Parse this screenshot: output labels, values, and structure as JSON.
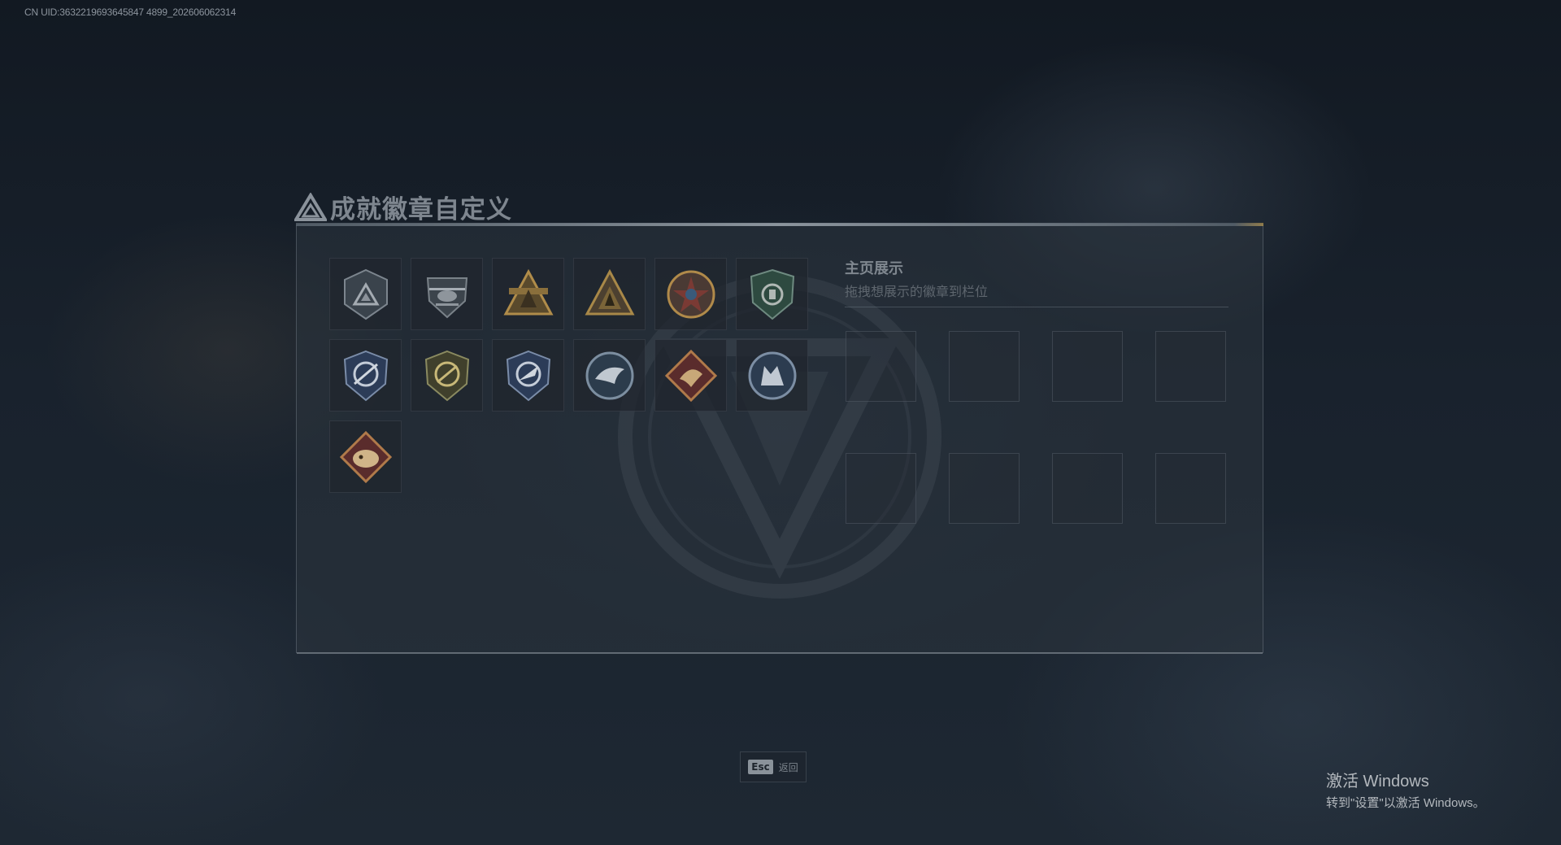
{
  "uid": "CN UID:3632219693645847 4899_202606062314",
  "title": "成就徽章自定义",
  "badges": [
    {
      "name": "triangle-shield-badge"
    },
    {
      "name": "helicopter-badge"
    },
    {
      "name": "gold-triangle-badge"
    },
    {
      "name": "gold-mountain-triangle-badge"
    },
    {
      "name": "star-compass-badge"
    },
    {
      "name": "green-shield-badge"
    },
    {
      "name": "blue-wing-shield-badge"
    },
    {
      "name": "no-jet-shield-badge"
    },
    {
      "name": "blue-jet-shield-badge"
    },
    {
      "name": "eagle-circle-badge"
    },
    {
      "name": "dragon-diamond-badge"
    },
    {
      "name": "wolf-circle-badge"
    },
    {
      "name": "tiger-diamond-badge"
    }
  ],
  "showcase": {
    "title": "主页展示",
    "subtitle": "拖拽想展示的徽章到栏位"
  },
  "esc": {
    "key": "Esc",
    "label": "返回"
  },
  "windows": {
    "title": "激活 Windows",
    "subtitle": "转到\"设置\"以激活 Windows。"
  }
}
